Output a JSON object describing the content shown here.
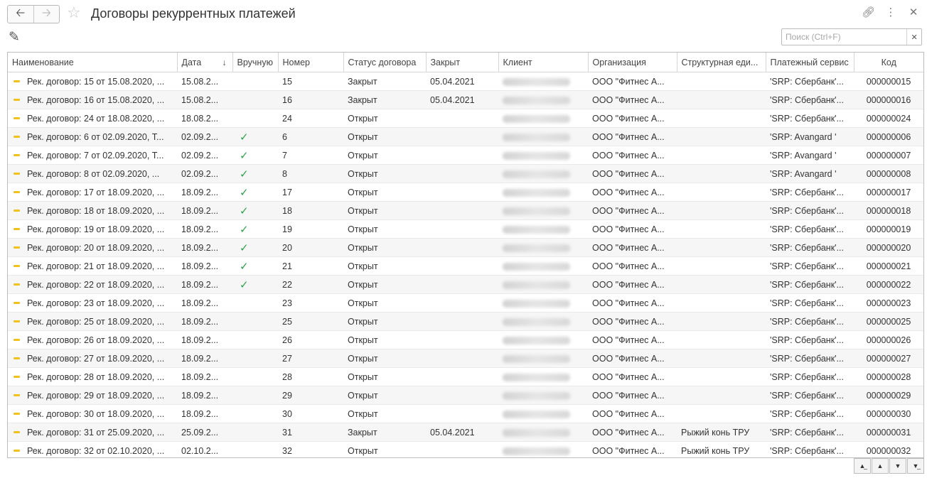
{
  "window": {
    "title": "Договоры рекуррентных платежей",
    "back_icon": "arrow-left-icon",
    "forward_icon": "arrow-right-icon",
    "favorite_icon": "star-icon",
    "link_icon": "link-icon",
    "more_icon": "more-vertical-icon",
    "close_icon": "close-icon"
  },
  "toolbar": {
    "edit_icon": "pencil-icon",
    "search_placeholder": "Поиск (Ctrl+F)",
    "search_value": "",
    "search_clear_icon": "close-icon"
  },
  "table": {
    "columns": [
      "Наименование",
      "Дата",
      "Вручную",
      "Номер",
      "Статус договора",
      "Закрыт",
      "Клиент",
      "Организация",
      "Структурная еди...",
      "Платежный сервис",
      "Код"
    ],
    "sorted_column": "Дата",
    "sort_direction": "descending-arrow",
    "rows": [
      {
        "name": "Рек. договор: 15 от 15.08.2020, ...",
        "date": "15.08.2...",
        "manual": false,
        "number": "15",
        "status": "Закрыт",
        "closed": "05.04.2021",
        "client_width": 95,
        "org": "ООО \"Фитнес А...",
        "unit": "",
        "service": "'SRP: Сбербанк'...",
        "code": "000000015"
      },
      {
        "name": "Рек. договор: 16 от 15.08.2020, ...",
        "date": "15.08.2...",
        "manual": false,
        "number": "16",
        "status": "Закрыт",
        "closed": "05.04.2021",
        "client_width": 95,
        "org": "ООО \"Фитнес А...",
        "unit": "",
        "service": "'SRP: Сбербанк'...",
        "code": "000000016"
      },
      {
        "name": "Рек. договор: 24 от 18.08.2020, ...",
        "date": "18.08.2...",
        "manual": false,
        "number": "24",
        "status": "Открыт",
        "closed": "",
        "client_width": 95,
        "org": "ООО \"Фитнес А...",
        "unit": "",
        "service": "'SRP: Сбербанк'...",
        "code": "000000024"
      },
      {
        "name": "Рек. договор: 6 от 02.09.2020, Т...",
        "date": "02.09.2...",
        "manual": true,
        "number": "6",
        "status": "Открыт",
        "closed": "",
        "client_width": 95,
        "org": "ООО \"Фитнес А...",
        "unit": "",
        "service": "'SRP: Avangard '",
        "code": "000000006"
      },
      {
        "name": "Рек. договор: 7 от 02.09.2020, Т...",
        "date": "02.09.2...",
        "manual": true,
        "number": "7",
        "status": "Открыт",
        "closed": "",
        "client_width": 95,
        "org": "ООО \"Фитнес А...",
        "unit": "",
        "service": "'SRP: Avangard '",
        "code": "000000007"
      },
      {
        "name": "Рек. договор: 8 от 02.09.2020, ...",
        "date": "02.09.2...",
        "manual": true,
        "number": "8",
        "status": "Открыт",
        "closed": "",
        "client_width": 95,
        "org": "ООО \"Фитнес А...",
        "unit": "",
        "service": "'SRP: Avangard '",
        "code": "000000008"
      },
      {
        "name": "Рек. договор: 17 от 18.09.2020, ...",
        "date": "18.09.2...",
        "manual": true,
        "number": "17",
        "status": "Открыт",
        "closed": "",
        "client_width": 95,
        "org": "ООО \"Фитнес А...",
        "unit": "",
        "service": "'SRP: Сбербанк'...",
        "code": "000000017"
      },
      {
        "name": "Рек. договор: 18 от 18.09.2020, ...",
        "date": "18.09.2...",
        "manual": true,
        "number": "18",
        "status": "Открыт",
        "closed": "",
        "client_width": 95,
        "org": "ООО \"Фитнес А...",
        "unit": "",
        "service": "'SRP: Сбербанк'...",
        "code": "000000018"
      },
      {
        "name": "Рек. договор: 19 от 18.09.2020, ...",
        "date": "18.09.2...",
        "manual": true,
        "number": "19",
        "status": "Открыт",
        "closed": "",
        "client_width": 95,
        "org": "ООО \"Фитнес А...",
        "unit": "",
        "service": "'SRP: Сбербанк'...",
        "code": "000000019"
      },
      {
        "name": "Рек. договор: 20 от 18.09.2020, ...",
        "date": "18.09.2...",
        "manual": true,
        "number": "20",
        "status": "Открыт",
        "closed": "",
        "client_width": 95,
        "org": "ООО \"Фитнес А...",
        "unit": "",
        "service": "'SRP: Сбербанк'...",
        "code": "000000020"
      },
      {
        "name": "Рек. договор: 21 от 18.09.2020, ...",
        "date": "18.09.2...",
        "manual": true,
        "number": "21",
        "status": "Открыт",
        "closed": "",
        "client_width": 95,
        "org": "ООО \"Фитнес А...",
        "unit": "",
        "service": "'SRP: Сбербанк'...",
        "code": "000000021"
      },
      {
        "name": "Рек. договор: 22 от 18.09.2020, ...",
        "date": "18.09.2...",
        "manual": true,
        "number": "22",
        "status": "Открыт",
        "closed": "",
        "client_width": 95,
        "org": "ООО \"Фитнес А...",
        "unit": "",
        "service": "'SRP: Сбербанк'...",
        "code": "000000022"
      },
      {
        "name": "Рек. договор: 23 от 18.09.2020, ...",
        "date": "18.09.2...",
        "manual": false,
        "number": "23",
        "status": "Открыт",
        "closed": "",
        "client_width": 95,
        "org": "ООО \"Фитнес А...",
        "unit": "",
        "service": "'SRP: Сбербанк'...",
        "code": "000000023"
      },
      {
        "name": "Рек. договор: 25 от 18.09.2020, ...",
        "date": "18.09.2...",
        "manual": false,
        "number": "25",
        "status": "Открыт",
        "closed": "",
        "client_width": 95,
        "org": "ООО \"Фитнес А...",
        "unit": "",
        "service": "'SRP: Сбербанк'...",
        "code": "000000025"
      },
      {
        "name": "Рек. договор: 26 от 18.09.2020, ...",
        "date": "18.09.2...",
        "manual": false,
        "number": "26",
        "status": "Открыт",
        "closed": "",
        "client_width": 95,
        "org": "ООО \"Фитнес А...",
        "unit": "",
        "service": "'SRP: Сбербанк'...",
        "code": "000000026"
      },
      {
        "name": "Рек. договор: 27 от 18.09.2020, ...",
        "date": "18.09.2...",
        "manual": false,
        "number": "27",
        "status": "Открыт",
        "closed": "",
        "client_width": 95,
        "org": "ООО \"Фитнес А...",
        "unit": "",
        "service": "'SRP: Сбербанк'...",
        "code": "000000027"
      },
      {
        "name": "Рек. договор: 28 от 18.09.2020, ...",
        "date": "18.09.2...",
        "manual": false,
        "number": "28",
        "status": "Открыт",
        "closed": "",
        "client_width": 95,
        "org": "ООО \"Фитнес А...",
        "unit": "",
        "service": "'SRP: Сбербанк'...",
        "code": "000000028"
      },
      {
        "name": "Рек. договор: 29 от 18.09.2020, ...",
        "date": "18.09.2...",
        "manual": false,
        "number": "29",
        "status": "Открыт",
        "closed": "",
        "client_width": 95,
        "org": "ООО \"Фитнес А...",
        "unit": "",
        "service": "'SRP: Сбербанк'...",
        "code": "000000029"
      },
      {
        "name": "Рек. договор: 30 от 18.09.2020, ...",
        "date": "18.09.2...",
        "manual": false,
        "number": "30",
        "status": "Открыт",
        "closed": "",
        "client_width": 95,
        "org": "ООО \"Фитнес А...",
        "unit": "",
        "service": "'SRP: Сбербанк'...",
        "code": "000000030"
      },
      {
        "name": "Рек. договор: 31 от 25.09.2020, ...",
        "date": "25.09.2...",
        "manual": false,
        "number": "31",
        "status": "Закрыт",
        "closed": "05.04.2021",
        "client_width": 95,
        "org": "ООО \"Фитнес А...",
        "unit": "Рыжий конь ТРУ",
        "service": "'SRP: Сбербанк'...",
        "code": "000000031"
      },
      {
        "name": "Рек. договор: 32 от 02.10.2020, ...",
        "date": "02.10.2...",
        "manual": false,
        "number": "32",
        "status": "Открыт",
        "closed": "",
        "client_width": 95,
        "org": "ООО \"Фитнес А...",
        "unit": "Рыжий конь ТРУ",
        "service": "'SRP: Сбербанк'...",
        "code": "000000032"
      }
    ]
  },
  "pager": {
    "first_icon": "scroll-to-top-icon",
    "prev_icon": "scroll-up-icon",
    "next_icon": "scroll-down-icon",
    "last_icon": "scroll-to-bottom-icon"
  }
}
